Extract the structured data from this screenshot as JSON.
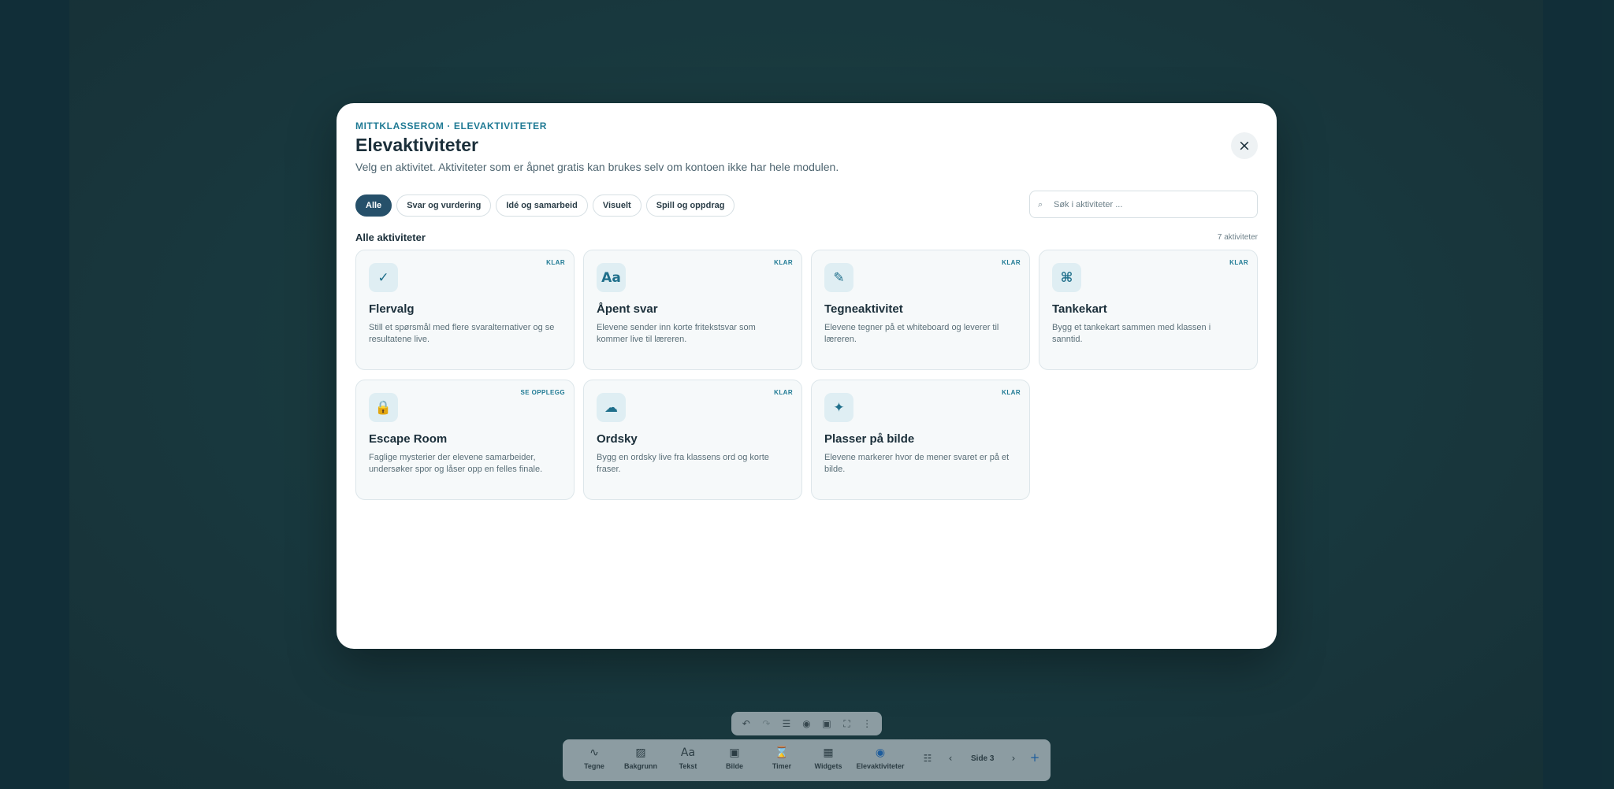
{
  "modal": {
    "eyebrow": "MITTKLASSEROM · ELEVAKTIVITETER",
    "title": "Elevaktiviteter",
    "subtitle": "Velg en aktivitet. Aktiviteter som er åpnet gratis kan brukes selv om kontoen ikke har hele modulen.",
    "close_label": "×"
  },
  "filters": [
    {
      "label": "Alle",
      "active": true
    },
    {
      "label": "Svar og vurdering"
    },
    {
      "label": "Idé og samarbeid"
    },
    {
      "label": "Visuelt"
    },
    {
      "label": "Spill og oppdrag"
    }
  ],
  "search": {
    "placeholder": "Søk i aktiviteter ...",
    "icon": "search-icon"
  },
  "section": {
    "title": "Alle aktiviteter",
    "count": "7 aktiviteter"
  },
  "cards": [
    {
      "icon": "✓",
      "icon_name": "check-icon",
      "badge": "KLAR",
      "title": "Flervalg",
      "desc": "Still et spørsmål med flere svaralternativer og se resultatene live."
    },
    {
      "icon": "Aa",
      "icon_name": "text-icon",
      "badge": "KLAR",
      "title": "Åpent svar",
      "desc": "Elevene sender inn korte fritekstsvar som kommer live til læreren."
    },
    {
      "icon": "✎",
      "icon_name": "pencil-icon",
      "badge": "KLAR",
      "title": "Tegneaktivitet",
      "desc": "Elevene tegner på et whiteboard og leverer til læreren."
    },
    {
      "icon": "⌘",
      "icon_name": "mindmap-icon",
      "badge": "KLAR",
      "title": "Tankekart",
      "desc": "Bygg et tankekart sammen med klassen i sanntid."
    },
    {
      "icon": "🔒",
      "icon_name": "lock-icon",
      "badge": "SE OPPLEGG",
      "title": "Escape Room",
      "desc": "Faglige mysterier der elevene samarbeider, undersøker spor og låser opp en felles finale."
    },
    {
      "icon": "☁",
      "icon_name": "cloud-icon",
      "badge": "KLAR",
      "title": "Ordsky",
      "desc": "Bygg en ordsky live fra klassens ord og korte fraser."
    },
    {
      "icon": "✦",
      "icon_name": "pin-icon",
      "badge": "KLAR",
      "title": "Plasser på bilde",
      "desc": "Elevene markerer hvor de mener svaret er på et bilde."
    }
  ],
  "mini_toolbar": [
    {
      "icon": "↶",
      "name": "undo-icon"
    },
    {
      "icon": "↷",
      "name": "redo-icon"
    },
    {
      "icon": "☰",
      "name": "menu-icon"
    },
    {
      "icon": "◉",
      "name": "record-icon"
    },
    {
      "icon": "▣",
      "name": "screen-icon"
    },
    {
      "icon": "⛶",
      "name": "fullscreen-icon"
    },
    {
      "icon": "⋮",
      "name": "more-icon"
    }
  ],
  "toolbar": {
    "tools": [
      {
        "icon": "∿",
        "name": "draw-icon",
        "label": "Tegne"
      },
      {
        "icon": "▨",
        "name": "background-icon",
        "label": "Bakgrunn"
      },
      {
        "icon": "Aa",
        "name": "text-icon",
        "label": "Tekst"
      },
      {
        "icon": "▣",
        "name": "image-icon",
        "label": "Bilde"
      },
      {
        "icon": "⌛",
        "name": "timer-icon",
        "label": "Timer"
      },
      {
        "icon": "▦",
        "name": "widgets-icon",
        "label": "Widgets"
      },
      {
        "icon": "◉",
        "name": "activities-icon",
        "label": "Elevaktiviteter"
      }
    ],
    "pages_icon": "☷",
    "prev": "‹",
    "page_label": "Side 3",
    "next": "›",
    "add": "+"
  }
}
